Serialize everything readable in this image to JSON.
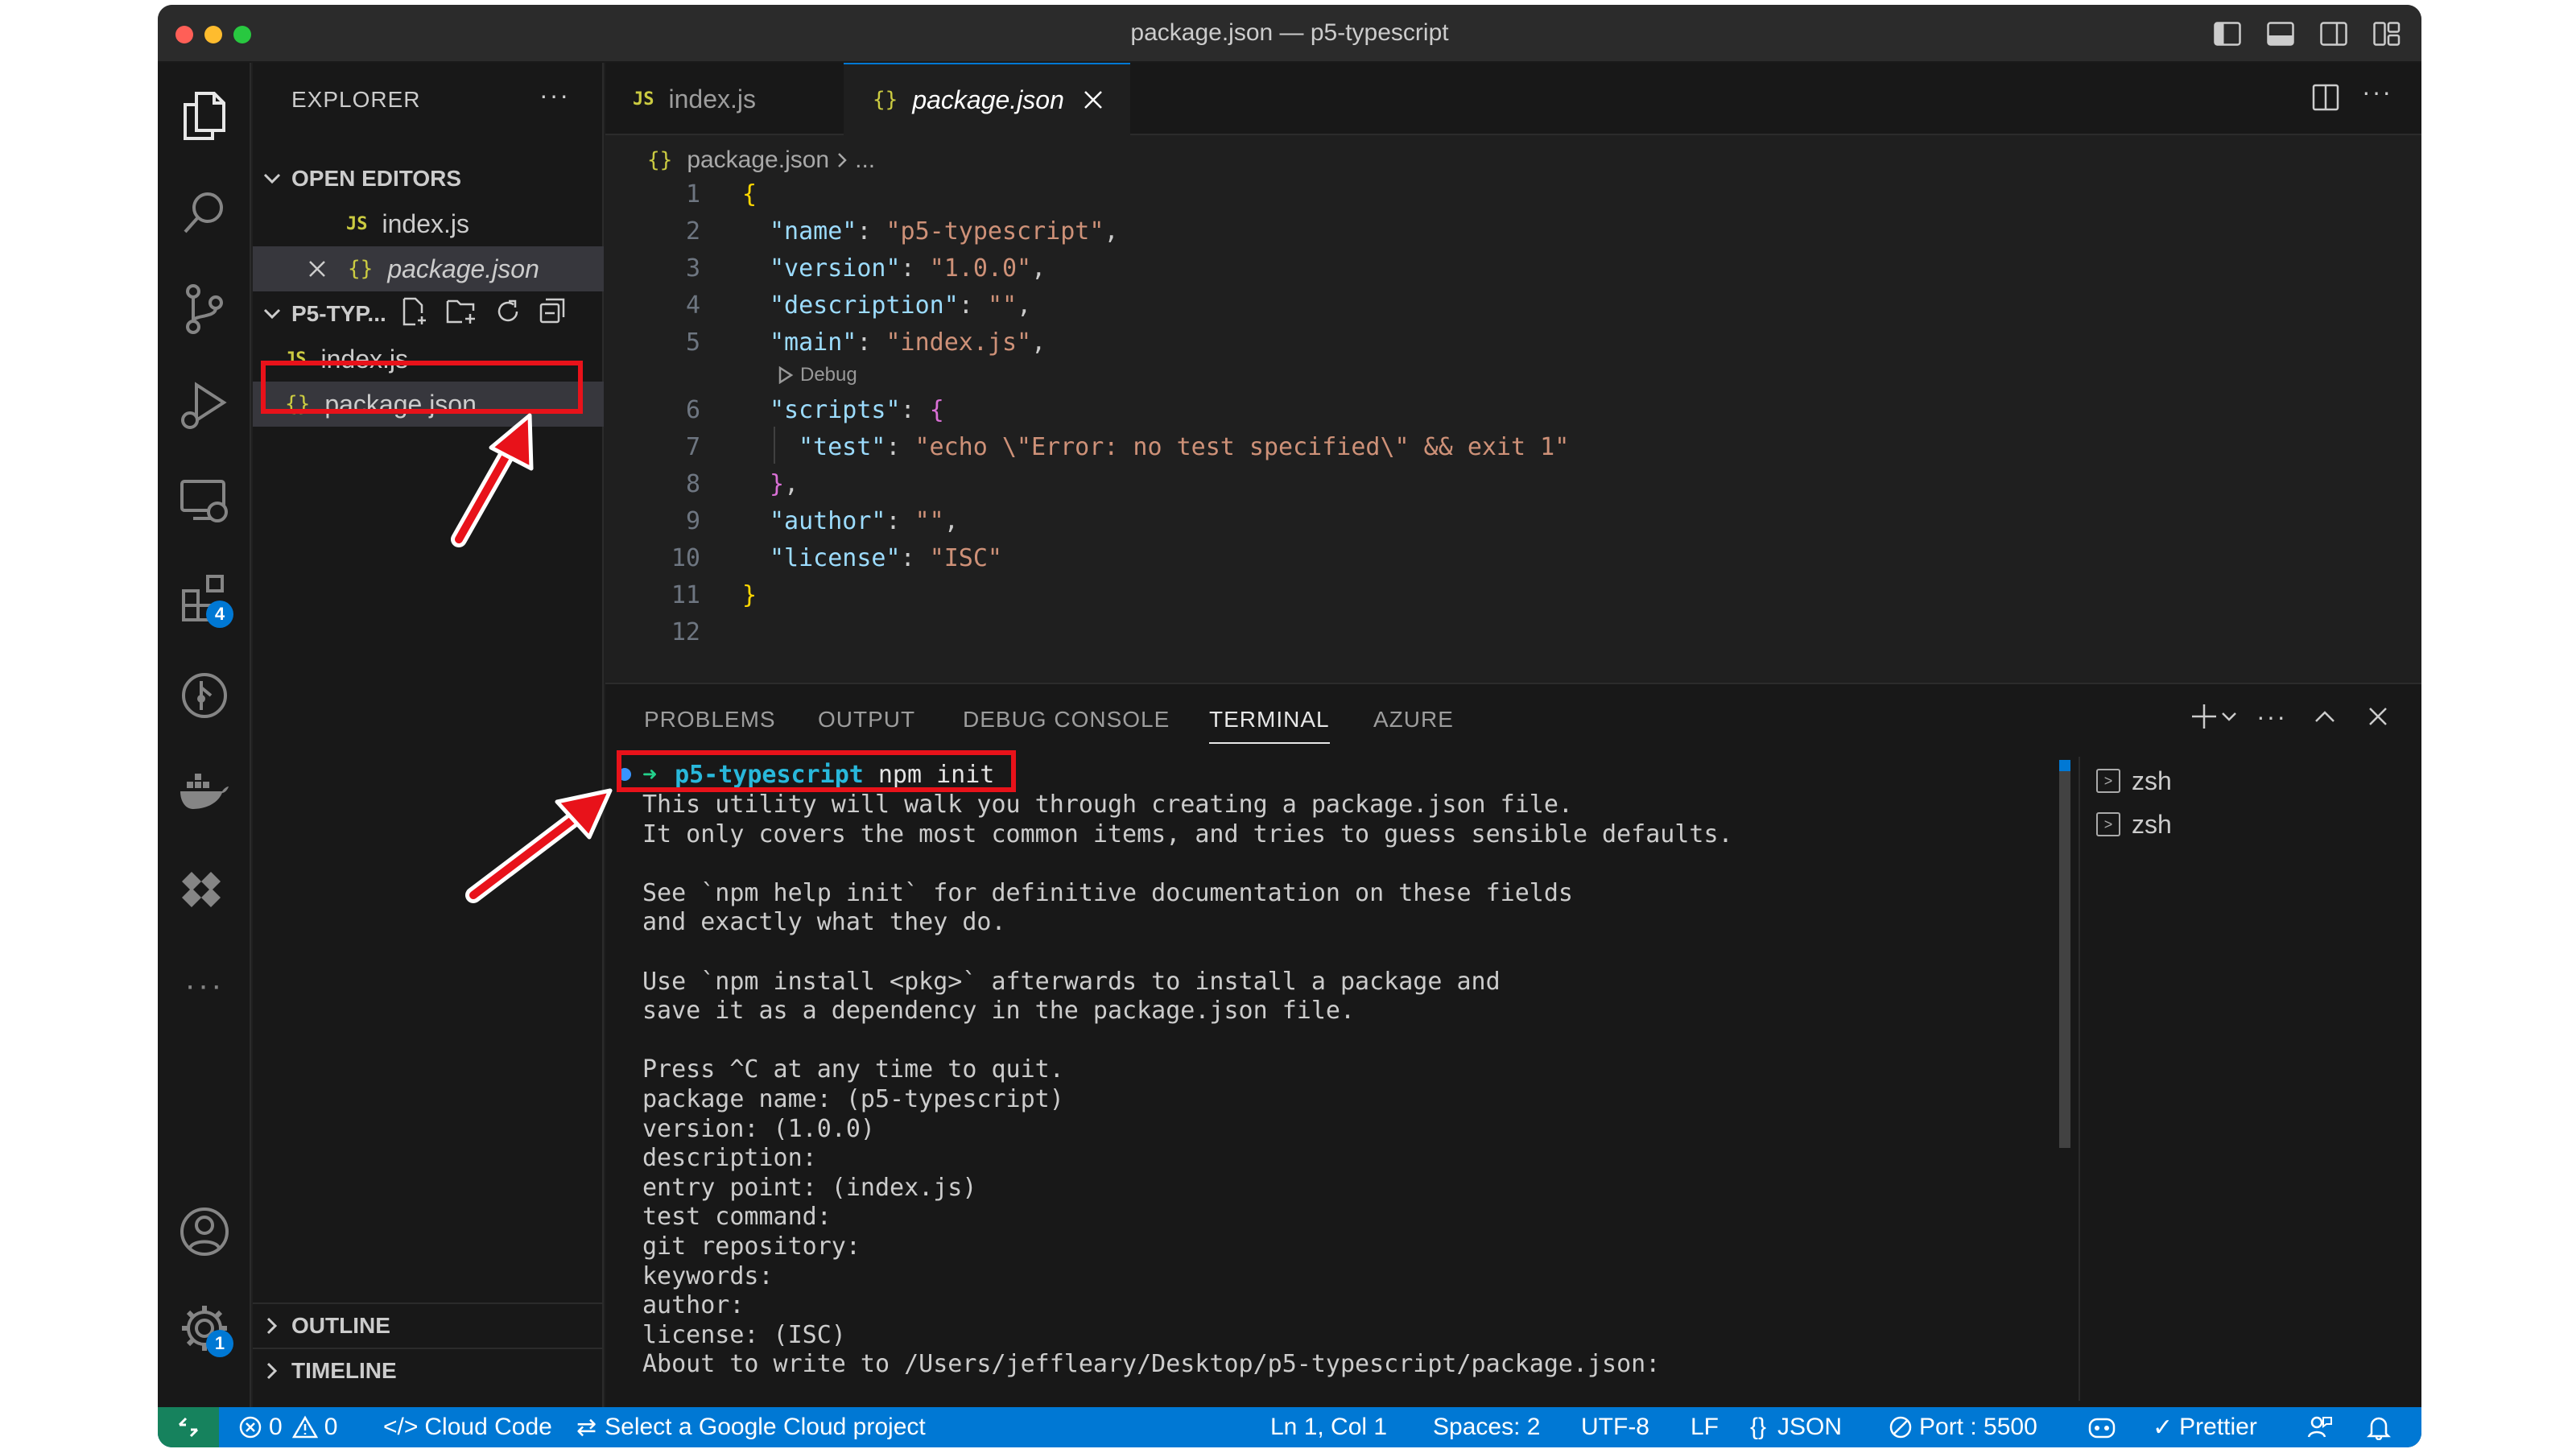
{
  "window": {
    "title": "package.json — p5-typescript"
  },
  "activity_bar": {
    "extensions_badge": "4",
    "settings_badge": "1",
    "more_label": "···"
  },
  "sidebar": {
    "title": "EXPLORER",
    "more": "···",
    "open_editors": {
      "label": "OPEN EDITORS",
      "items": [
        {
          "icon": "JS",
          "name": "index.js"
        },
        {
          "icon": "{}",
          "name": "package.json"
        }
      ]
    },
    "folder": {
      "label": "P5-TYP...",
      "items": [
        {
          "icon": "JS",
          "name": "index.js"
        },
        {
          "icon": "{}",
          "name": "package.json"
        }
      ]
    },
    "outline_label": "OUTLINE",
    "timeline_label": "TIMELINE"
  },
  "editor": {
    "tabs": [
      {
        "icon": "JS",
        "label": "index.js"
      },
      {
        "icon": "{}",
        "label": "package.json"
      }
    ],
    "breadcrumb": {
      "icon": "{}",
      "file": "package.json",
      "rest": "..."
    },
    "codelens": "Debug",
    "line_numbers": [
      "1",
      "2",
      "3",
      "4",
      "5",
      "6",
      "7",
      "8",
      "9",
      "10",
      "11",
      "12"
    ],
    "lines": {
      "l1": "{",
      "l2_key": "\"name\"",
      "l2_val": "\"p5-typescript\"",
      "l3_key": "\"version\"",
      "l3_val": "\"1.0.0\"",
      "l4_key": "\"description\"",
      "l4_val": "\"\"",
      "l5_key": "\"main\"",
      "l5_val": "\"index.js\"",
      "l6_key": "\"scripts\"",
      "l6_brace": "{",
      "l7_key": "\"test\"",
      "l7_val": "\"echo \\\"Error: no test specified\\\" && exit 1\"",
      "l8_brace": "}",
      "l9_key": "\"author\"",
      "l9_val": "\"\"",
      "l10_key": "\"license\"",
      "l10_val": "\"ISC\"",
      "l11": "}"
    }
  },
  "panel": {
    "tabs": [
      "PROBLEMS",
      "OUTPUT",
      "DEBUG CONSOLE",
      "TERMINAL",
      "AZURE"
    ],
    "active_tab": "TERMINAL",
    "prompt": {
      "arrow": "➜",
      "dir": "p5-typescript",
      "command": "npm init"
    },
    "terminal_text": "This utility will walk you through creating a package.json file.\nIt only covers the most common items, and tries to guess sensible defaults.\n\nSee `npm help init` for definitive documentation on these fields\nand exactly what they do.\n\nUse `npm install <pkg>` afterwards to install a package and\nsave it as a dependency in the package.json file.\n\nPress ^C at any time to quit.\npackage name: (p5-typescript)\nversion: (1.0.0)\ndescription:\nentry point: (index.js)\ntest command:\ngit repository:\nkeywords:\nauthor:\nlicense: (ISC)\nAbout to write to /Users/jeffleary/Desktop/p5-typescript/package.json:",
    "shells": [
      "zsh",
      "zsh"
    ]
  },
  "statusbar": {
    "errors": "0",
    "warnings": "0",
    "cloud_code": "Cloud Code",
    "gcp": "Select a Google Cloud project",
    "position": "Ln 1, Col 1",
    "spaces": "Spaces: 2",
    "encoding": "UTF-8",
    "eol": "LF",
    "language": "JSON",
    "port": "Port : 5500",
    "prettier": "Prettier"
  },
  "colors": {
    "accent": "#0078d4",
    "annotation": "#e8121a",
    "json_key": "#9cdcfe",
    "json_string": "#ce9178",
    "terminal_dir": "#29b8db"
  }
}
